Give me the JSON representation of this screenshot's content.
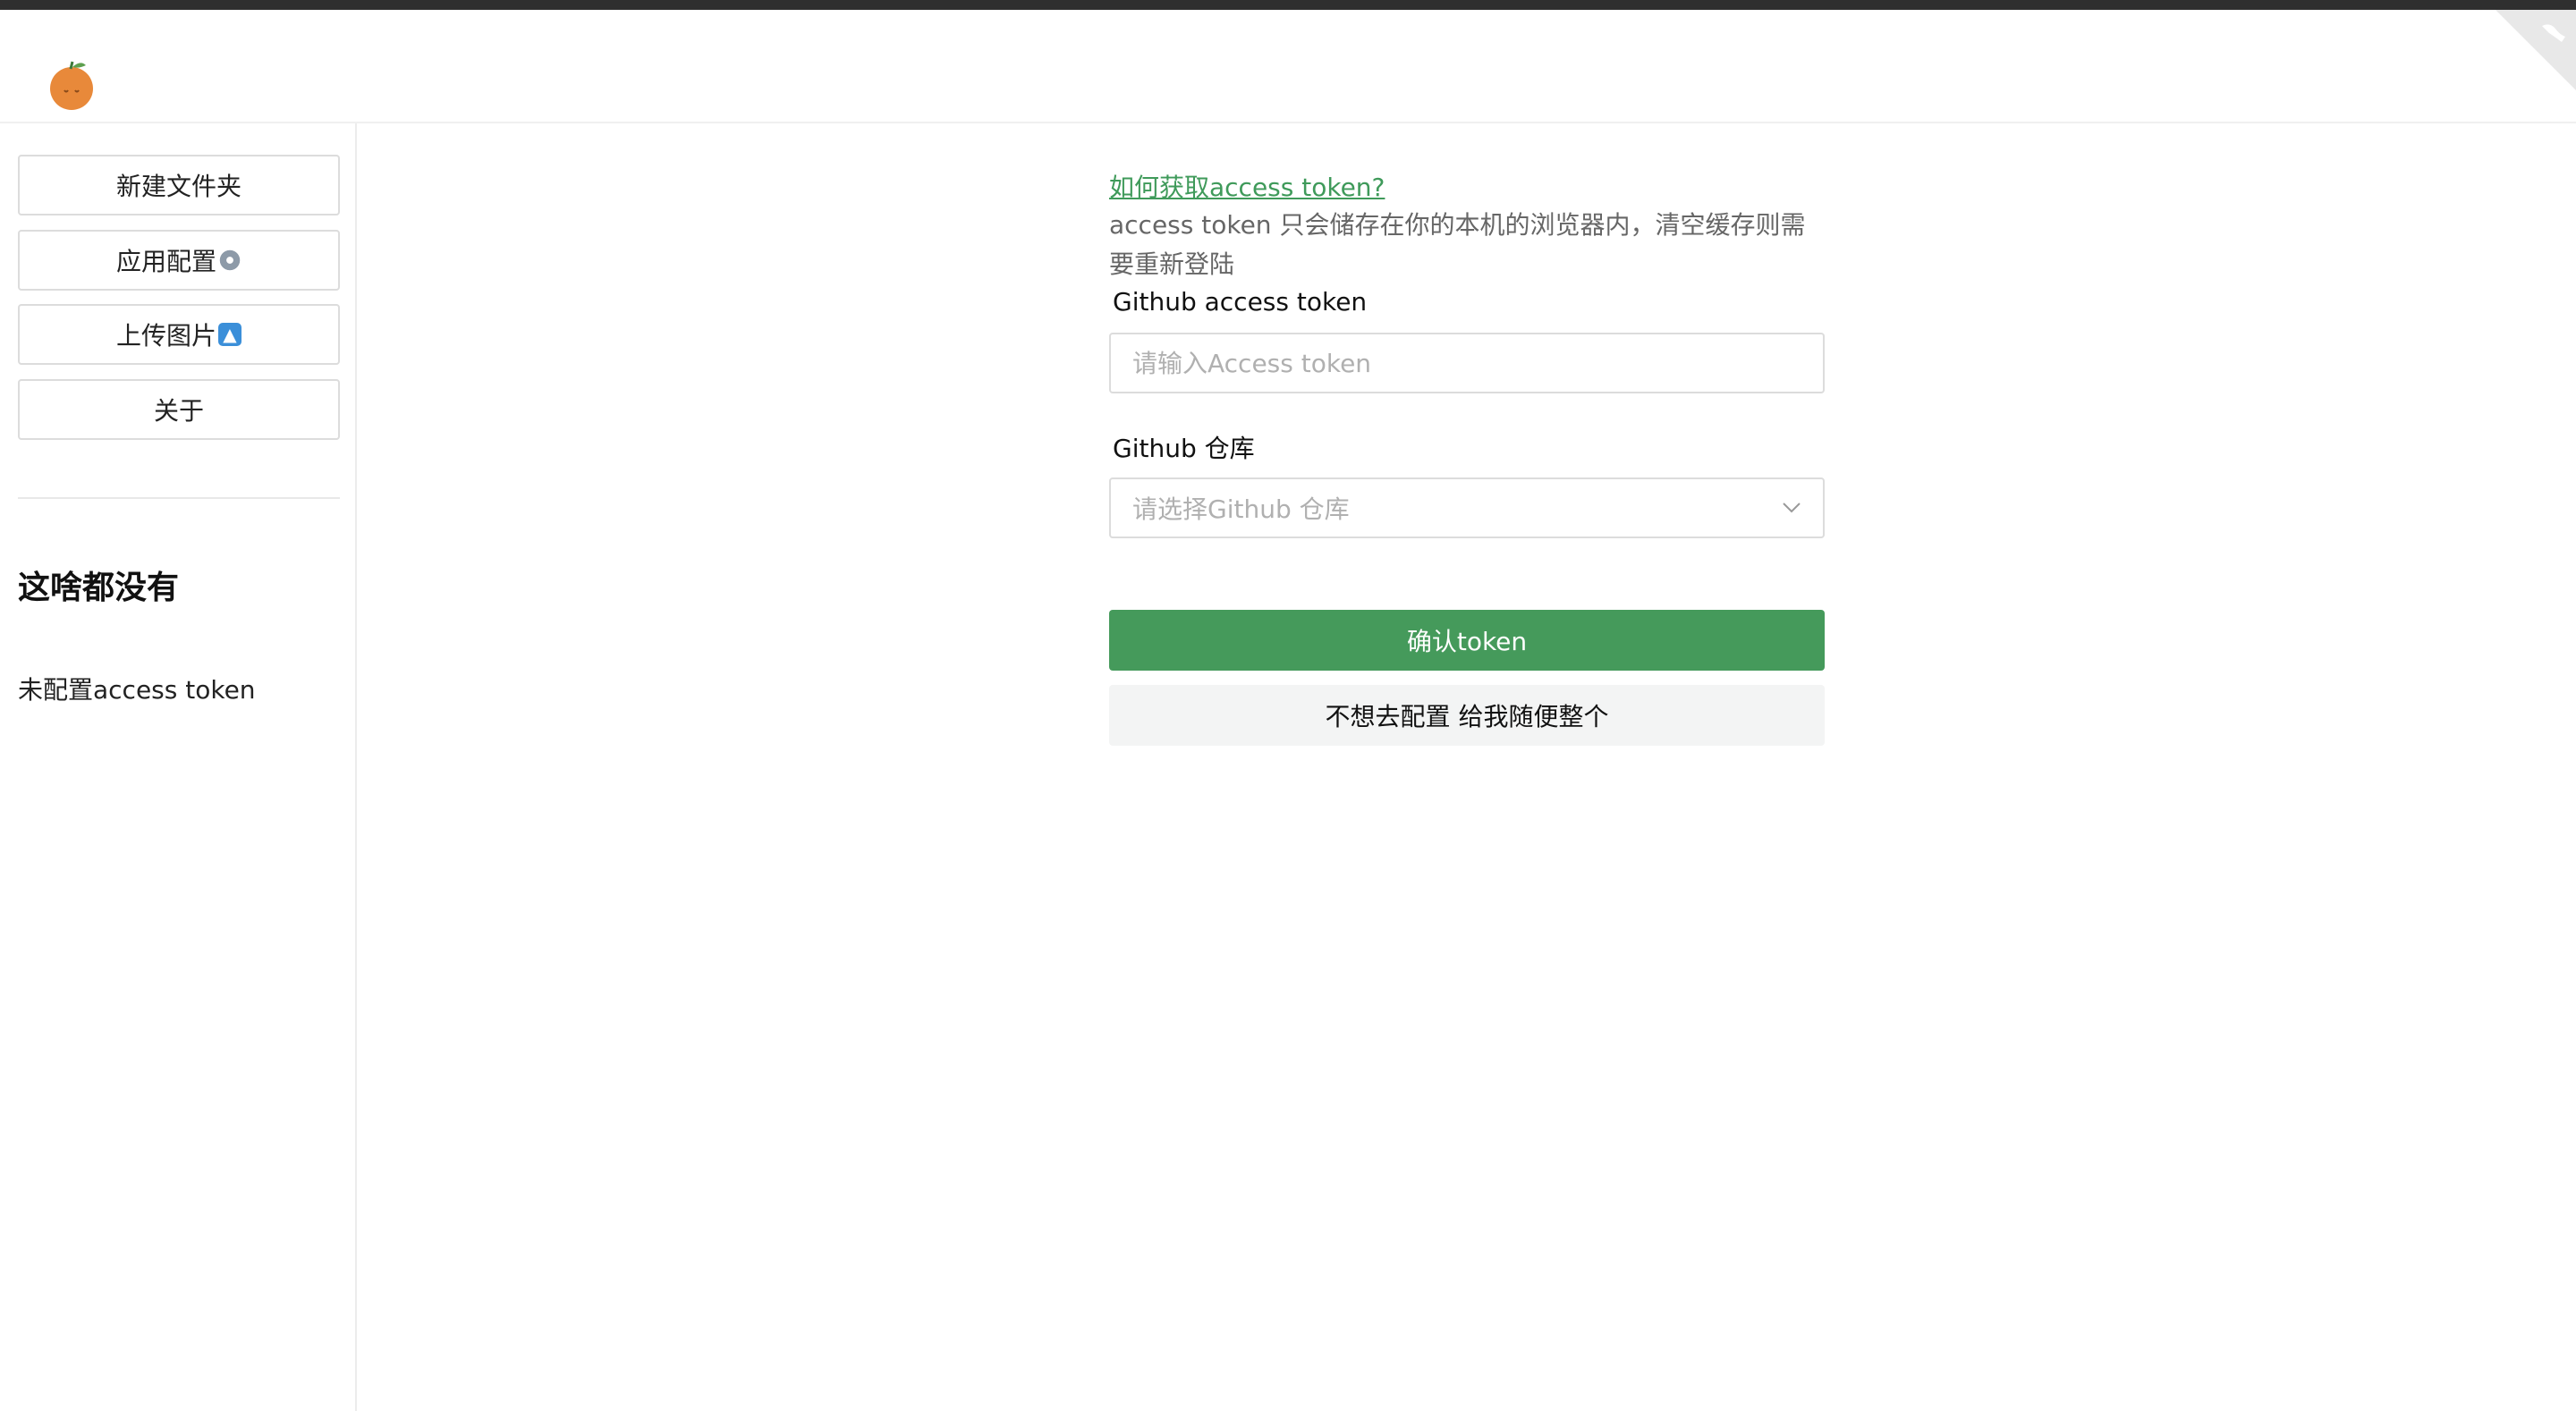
{
  "sidebar": {
    "buttons": [
      {
        "label": "新建文件夹"
      },
      {
        "label": "应用配置"
      },
      {
        "label": "上传图片"
      },
      {
        "label": "关于"
      }
    ],
    "empty_title": "这啥都没有",
    "empty_note": "未配置access token"
  },
  "form": {
    "help_link": "如何获取access token? ",
    "help_desc": "access token 只会储存在你的本机的浏览器内，清空缓存则需要重新登陆",
    "token_label": "Github access token",
    "token_placeholder": "请输入Access token",
    "token_value": "",
    "repo_label": "Github 仓库",
    "repo_placeholder": "请选择Github 仓库",
    "confirm_label": "确认token",
    "skip_label": "不想去配置 给我随便整个"
  },
  "colors": {
    "accent": "#459a5b",
    "link": "#3f9a5a",
    "topbar": "#2f2f2f"
  },
  "icons": {
    "logo": "orange-logo-icon",
    "settings": "gear-icon",
    "upload": "upload-arrow-icon",
    "dropdown": "chevron-down-icon",
    "corner": "github-corner-icon"
  }
}
